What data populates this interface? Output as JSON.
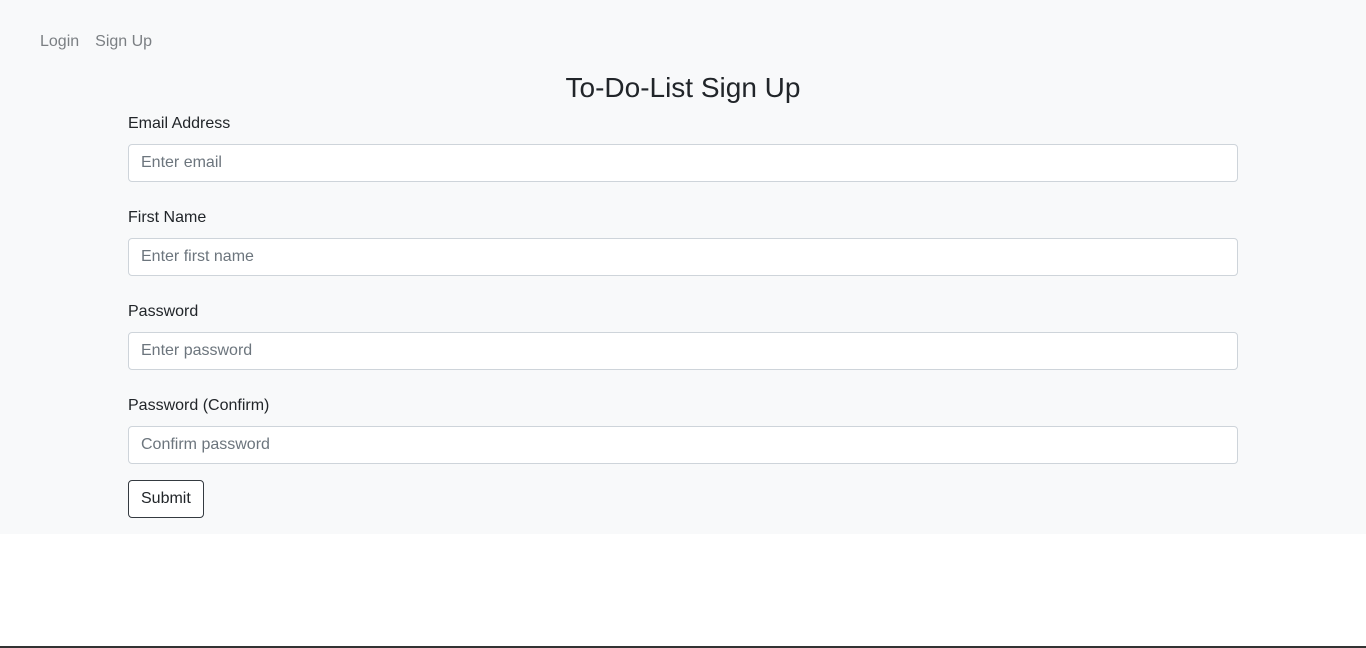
{
  "nav": {
    "login_label": "Login",
    "signup_label": "Sign Up"
  },
  "page_title": "To-Do-List Sign Up",
  "form": {
    "email": {
      "label": "Email Address",
      "placeholder": "Enter email",
      "value": ""
    },
    "first_name": {
      "label": "First Name",
      "placeholder": "Enter first name",
      "value": ""
    },
    "password": {
      "label": "Password",
      "placeholder": "Enter password",
      "value": ""
    },
    "password_confirm": {
      "label": "Password (Confirm)",
      "placeholder": "Confirm password",
      "value": ""
    },
    "submit_label": "Submit"
  },
  "colors": {
    "panel_background": "#f8f9fa",
    "nav_link": "#7b7f83",
    "button_border": "#343a40"
  }
}
